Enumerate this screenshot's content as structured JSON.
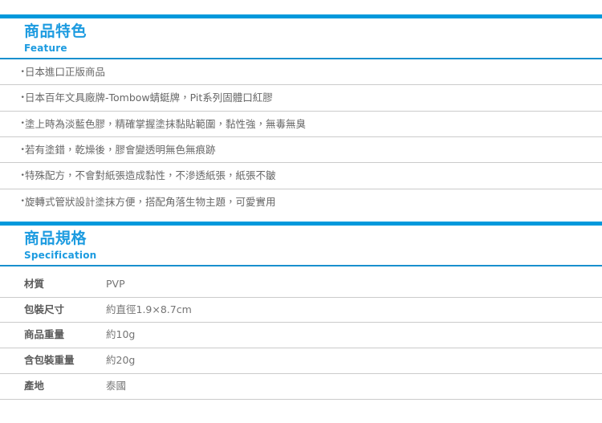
{
  "theme": {
    "accent_bar": "#0099DC",
    "accent_rule": "#1990CE",
    "heading_color": "#1C9BE0",
    "divider_color": "#CBCBCB",
    "body_text": "#676767",
    "label_text": "#5B5B5B"
  },
  "feature_section": {
    "title_zh": "商品特色",
    "title_en": "Feature",
    "bullet_glyph": "・",
    "items": [
      "日本進口正版商品",
      "日本百年文具廠牌-Tombow蜻蜓牌，Pit系列固體口紅膠",
      "塗上時為淡藍色膠，精確掌握塗抹黏貼範圍，黏性強，無毒無臭",
      "若有塗錯，乾燥後，膠會變透明無色無痕跡",
      "特殊配方，不會對紙張造成黏性，不滲透紙張，紙張不皺",
      "旋轉式管狀設計塗抹方便，搭配角落生物主題，可愛實用"
    ]
  },
  "spec_section": {
    "title_zh": "商品規格",
    "title_en": "Specification",
    "rows": [
      {
        "label": "材質",
        "value": "PVP"
      },
      {
        "label": "包裝尺寸",
        "value": "約直徑1.9×8.7cm"
      },
      {
        "label": "商品重量",
        "value": "約10g"
      },
      {
        "label": "含包裝重量",
        "value": "約20g"
      },
      {
        "label": "產地",
        "value": "泰國"
      }
    ]
  }
}
